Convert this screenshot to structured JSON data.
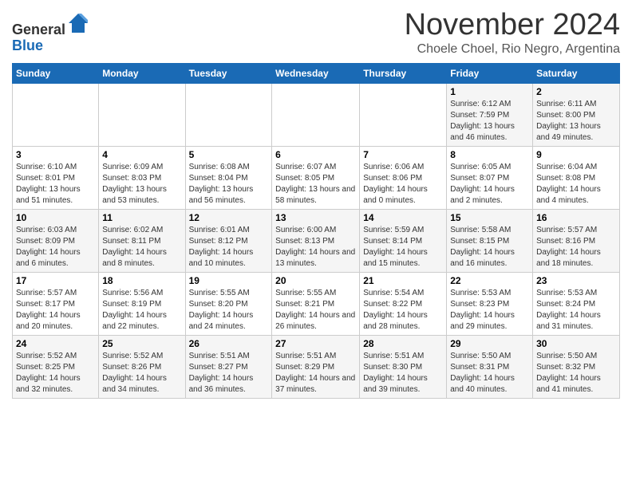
{
  "header": {
    "logo_general": "General",
    "logo_blue": "Blue",
    "month_title": "November 2024",
    "location": "Choele Choel, Rio Negro, Argentina"
  },
  "weekdays": [
    "Sunday",
    "Monday",
    "Tuesday",
    "Wednesday",
    "Thursday",
    "Friday",
    "Saturday"
  ],
  "weeks": [
    [
      {
        "day": "",
        "info": ""
      },
      {
        "day": "",
        "info": ""
      },
      {
        "day": "",
        "info": ""
      },
      {
        "day": "",
        "info": ""
      },
      {
        "day": "",
        "info": ""
      },
      {
        "day": "1",
        "info": "Sunrise: 6:12 AM\nSunset: 7:59 PM\nDaylight: 13 hours and 46 minutes."
      },
      {
        "day": "2",
        "info": "Sunrise: 6:11 AM\nSunset: 8:00 PM\nDaylight: 13 hours and 49 minutes."
      }
    ],
    [
      {
        "day": "3",
        "info": "Sunrise: 6:10 AM\nSunset: 8:01 PM\nDaylight: 13 hours and 51 minutes."
      },
      {
        "day": "4",
        "info": "Sunrise: 6:09 AM\nSunset: 8:03 PM\nDaylight: 13 hours and 53 minutes."
      },
      {
        "day": "5",
        "info": "Sunrise: 6:08 AM\nSunset: 8:04 PM\nDaylight: 13 hours and 56 minutes."
      },
      {
        "day": "6",
        "info": "Sunrise: 6:07 AM\nSunset: 8:05 PM\nDaylight: 13 hours and 58 minutes."
      },
      {
        "day": "7",
        "info": "Sunrise: 6:06 AM\nSunset: 8:06 PM\nDaylight: 14 hours and 0 minutes."
      },
      {
        "day": "8",
        "info": "Sunrise: 6:05 AM\nSunset: 8:07 PM\nDaylight: 14 hours and 2 minutes."
      },
      {
        "day": "9",
        "info": "Sunrise: 6:04 AM\nSunset: 8:08 PM\nDaylight: 14 hours and 4 minutes."
      }
    ],
    [
      {
        "day": "10",
        "info": "Sunrise: 6:03 AM\nSunset: 8:09 PM\nDaylight: 14 hours and 6 minutes."
      },
      {
        "day": "11",
        "info": "Sunrise: 6:02 AM\nSunset: 8:11 PM\nDaylight: 14 hours and 8 minutes."
      },
      {
        "day": "12",
        "info": "Sunrise: 6:01 AM\nSunset: 8:12 PM\nDaylight: 14 hours and 10 minutes."
      },
      {
        "day": "13",
        "info": "Sunrise: 6:00 AM\nSunset: 8:13 PM\nDaylight: 14 hours and 13 minutes."
      },
      {
        "day": "14",
        "info": "Sunrise: 5:59 AM\nSunset: 8:14 PM\nDaylight: 14 hours and 15 minutes."
      },
      {
        "day": "15",
        "info": "Sunrise: 5:58 AM\nSunset: 8:15 PM\nDaylight: 14 hours and 16 minutes."
      },
      {
        "day": "16",
        "info": "Sunrise: 5:57 AM\nSunset: 8:16 PM\nDaylight: 14 hours and 18 minutes."
      }
    ],
    [
      {
        "day": "17",
        "info": "Sunrise: 5:57 AM\nSunset: 8:17 PM\nDaylight: 14 hours and 20 minutes."
      },
      {
        "day": "18",
        "info": "Sunrise: 5:56 AM\nSunset: 8:19 PM\nDaylight: 14 hours and 22 minutes."
      },
      {
        "day": "19",
        "info": "Sunrise: 5:55 AM\nSunset: 8:20 PM\nDaylight: 14 hours and 24 minutes."
      },
      {
        "day": "20",
        "info": "Sunrise: 5:55 AM\nSunset: 8:21 PM\nDaylight: 14 hours and 26 minutes."
      },
      {
        "day": "21",
        "info": "Sunrise: 5:54 AM\nSunset: 8:22 PM\nDaylight: 14 hours and 28 minutes."
      },
      {
        "day": "22",
        "info": "Sunrise: 5:53 AM\nSunset: 8:23 PM\nDaylight: 14 hours and 29 minutes."
      },
      {
        "day": "23",
        "info": "Sunrise: 5:53 AM\nSunset: 8:24 PM\nDaylight: 14 hours and 31 minutes."
      }
    ],
    [
      {
        "day": "24",
        "info": "Sunrise: 5:52 AM\nSunset: 8:25 PM\nDaylight: 14 hours and 32 minutes."
      },
      {
        "day": "25",
        "info": "Sunrise: 5:52 AM\nSunset: 8:26 PM\nDaylight: 14 hours and 34 minutes."
      },
      {
        "day": "26",
        "info": "Sunrise: 5:51 AM\nSunset: 8:27 PM\nDaylight: 14 hours and 36 minutes."
      },
      {
        "day": "27",
        "info": "Sunrise: 5:51 AM\nSunset: 8:29 PM\nDaylight: 14 hours and 37 minutes."
      },
      {
        "day": "28",
        "info": "Sunrise: 5:51 AM\nSunset: 8:30 PM\nDaylight: 14 hours and 39 minutes."
      },
      {
        "day": "29",
        "info": "Sunrise: 5:50 AM\nSunset: 8:31 PM\nDaylight: 14 hours and 40 minutes."
      },
      {
        "day": "30",
        "info": "Sunrise: 5:50 AM\nSunset: 8:32 PM\nDaylight: 14 hours and 41 minutes."
      }
    ]
  ]
}
